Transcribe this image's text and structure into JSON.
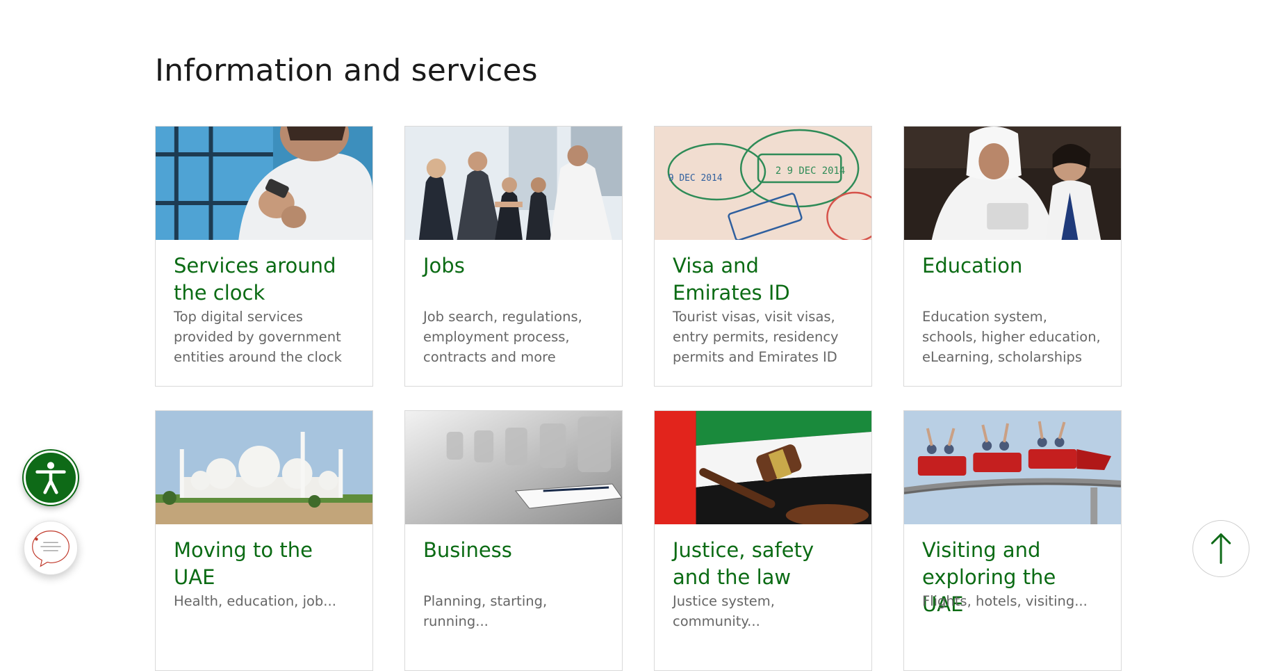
{
  "section": {
    "title": "Information and services"
  },
  "cards": [
    {
      "title": "Services around the clock",
      "description": "Top digital services provided by government entities around the clock",
      "image": "man-with-smartphone-photo"
    },
    {
      "title": "Jobs",
      "description": "Job search, regulations, employment process, contracts and more",
      "image": "business-handshake-photo"
    },
    {
      "title": "Visa and Emirates ID",
      "description": "Tourist visas, visit visas, entry permits, residency permits and Emirates ID",
      "image": "passport-stamps-photo"
    },
    {
      "title": "Education",
      "description": "Education system, schools, higher education, eLearning, scholarships",
      "image": "leader-with-student-photo"
    },
    {
      "title": "Moving to the UAE",
      "description": "Health, education, job...",
      "image": "grand-mosque-photo"
    },
    {
      "title": "Business",
      "description": "Planning, starting, running...",
      "image": "boardroom-chairs-photo"
    },
    {
      "title": "Justice, safety and the law",
      "description": "Justice system, community...",
      "image": "gavel-and-flag-photo"
    },
    {
      "title": "Visiting and exploring the UAE",
      "description": "Flights, hotels, visiting...",
      "image": "roller-coaster-photo"
    }
  ],
  "widgets": {
    "accessibility": "accessibility-icon",
    "chat": "chat-icon",
    "back_to_top": "arrow-up-icon"
  },
  "colors": {
    "accent": "#0b6b14",
    "fab_green": "#0e6a17",
    "text_body": "#666666"
  }
}
